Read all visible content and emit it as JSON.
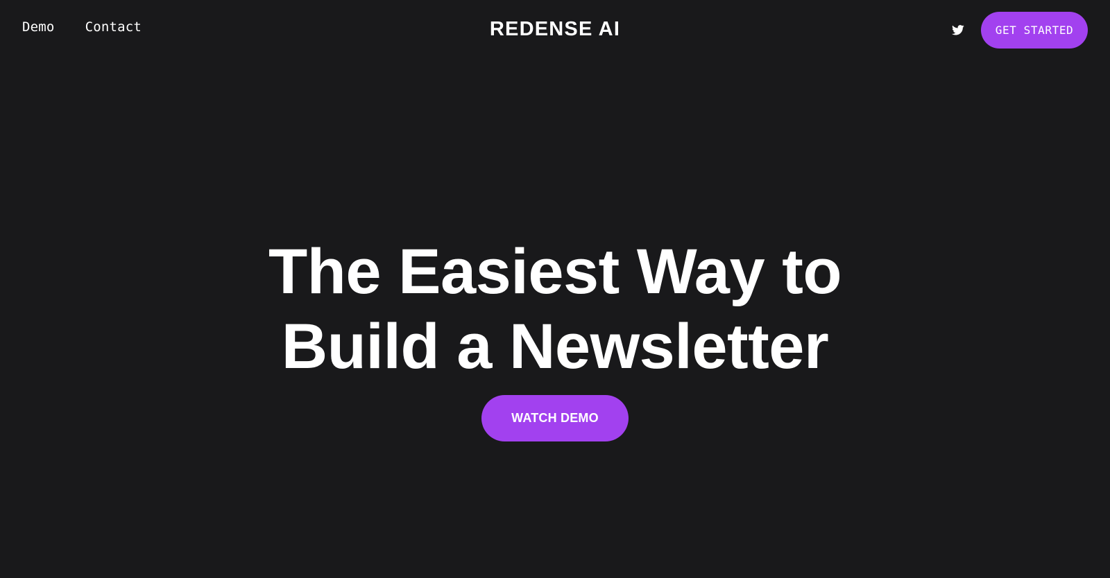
{
  "nav": {
    "links": [
      {
        "label": "Demo"
      },
      {
        "label": "Contact"
      }
    ],
    "brand": "REDENSE AI",
    "social_icon": "twitter-icon",
    "cta_label": "GET STARTED"
  },
  "hero": {
    "title_line_1": "The Easiest Way to",
    "title_line_2": "Build a Newsletter",
    "button_label": "WATCH DEMO"
  },
  "colors": {
    "background": "#19191b",
    "accent": "#a241ef",
    "text": "#ffffff"
  }
}
